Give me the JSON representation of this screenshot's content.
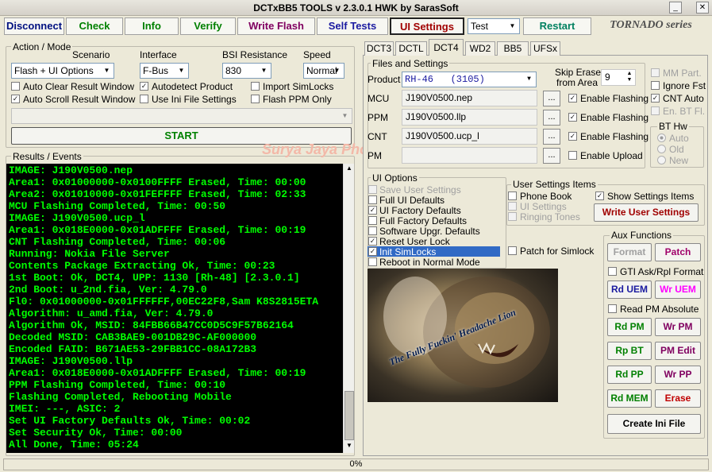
{
  "window": {
    "title": "DCTxBB5 TOOLS v 2.3.0.1 HWK by SarasSoft"
  },
  "toolbar": {
    "disconnect": "Disconnect",
    "check": "Check",
    "info": "Info",
    "verify": "Verify",
    "write_flash": "Write Flash",
    "self_tests": "Self Tests",
    "ui_settings": "UI Settings",
    "test_combo": "Test",
    "restart": "Restart",
    "brand": "TORNADO series"
  },
  "action_mode": {
    "group": "Action / Mode",
    "scenario_label": "Scenario",
    "scenario_value": "Flash + UI Options",
    "interface_label": "Interface",
    "interface_value": "F-Bus",
    "bsi_label": "BSI Resistance",
    "bsi_value": "830",
    "speed_label": "Speed",
    "speed_value": "Normal",
    "auto_clear": "Auto Clear Result Window",
    "autodetect": "Autodetect Product",
    "import_simlocks": "Import SimLocks",
    "auto_scroll": "Auto Scroll Result Window",
    "use_ini": "Use Ini File Settings",
    "flash_ppm": "Flash PPM Only",
    "start": "START"
  },
  "results": {
    "group": "Results / Events",
    "watermark": "Surya Jaya Phones",
    "lines": [
      "IMAGE: J190V0500.nep",
      "Area1: 0x01000000-0x0100FFFF Erased, Time: 00:00",
      "Area2: 0x01010000-0x01FEFFFF Erased, Time: 02:33",
      "MCU Flashing Completed, Time: 00:50",
      "IMAGE: J190V0500.ucp_l",
      "Area1: 0x018E0000-0x01ADFFFF Erased, Time: 00:19",
      "CNT Flashing Completed, Time: 00:06",
      "Running: Nokia File Server",
      "Contents Package Extracting Ok, Time: 00:23",
      "1st Boot: Ok, DCT4, UPP: 1130 [Rh-48] [2.3.0.1]",
      "2nd Boot: u_2nd.fia, Ver: 4.79.0",
      "Fl0: 0x01000000-0x01FFFFFF,00EC22F8,Sam K8S2815ETA",
      "Algorithm: u_amd.fia, Ver: 4.79.0",
      "Algorithm Ok, MSID: 84FBB66B47CC0D5C9F57B62164",
      "Decoded MSID: CAB3BAE9-001DB29C-AF000000",
      "Encoded FAID: B671AE53-29FBB1CC-08A172B3",
      "IMAGE: J190V0500.llp",
      "Area1: 0x018E0000-0x01ADFFFF Erased, Time: 00:19",
      "PPM Flashing Completed, Time: 00:10",
      "Flashing Completed, Rebooting Mobile",
      "IMEI: ---, ASIC: 2",
      "Set UI Factory Defaults Ok, Time: 00:02",
      "Set Security Ok, Time: 00:00",
      "All Done, Time: 05:24"
    ]
  },
  "tabs": [
    "DCT3",
    "DCTL",
    "DCT4",
    "WD2",
    "BB5",
    "UFSx"
  ],
  "files": {
    "group": "Files and Settings",
    "product_label": "Product",
    "product_value": "RH-46   (3105)",
    "skip_erase_label1": "Skip Erase",
    "skip_erase_label2": "from Area",
    "skip_erase_value": "9",
    "mcu_label": "MCU",
    "mcu_value": "J190V0500.nep",
    "ppm_label": "PPM",
    "ppm_value": "J190V0500.llp",
    "cnt_label": "CNT",
    "cnt_value": "J190V0500.ucp_l",
    "pm_label": "PM",
    "pm_value": "",
    "browse": "...",
    "enable_flashing": "Enable Flashing",
    "enable_upload": "Enable Upload",
    "mm_part": "MM Part.",
    "ignore_fst": "Ignore Fst",
    "cnt_auto": "CNT Auto",
    "en_bt_fl": "En. BT Fl.",
    "bt_hw": "BT Hw",
    "bt_auto": "Auto",
    "bt_old": "Old",
    "bt_new": "New"
  },
  "ui_options": {
    "group": "UI Options",
    "items": [
      "Save User Settings",
      "Full UI Defaults",
      "UI Factory Defaults",
      "Full Factory Defaults",
      "Software Upgr. Defaults",
      "Reset User Lock",
      "Init SimLocks",
      "Reboot in Normal Mode"
    ],
    "patch_simlock": "Patch for Simlock"
  },
  "user_settings": {
    "group": "User Settings Items",
    "phone_book": "Phone Book",
    "ui_settings": "UI Settings",
    "ringing_tones": "Ringing Tones",
    "show_items": "Show Settings Items",
    "write_button": "Write User Settings"
  },
  "image": {
    "caption": "The Fully Fuckin' Headache Lion"
  },
  "aux": {
    "group": "Aux Functions",
    "format": "Format",
    "patch": "Patch",
    "gti": "GTI Ask/Rpl Format",
    "rd_uem": "Rd UEM",
    "wr_uem": "Wr UEM",
    "read_pm_abs": "Read PM Absolute",
    "rd_pm": "Rd PM",
    "wr_pm": "Wr PM",
    "rp_bt": "Rp BT",
    "pm_edit": "PM Edit",
    "rd_pp": "Rd PP",
    "wr_pp": "Wr PP",
    "rd_mem": "Rd MEM",
    "erase": "Erase",
    "create_ini": "Create Ini File"
  },
  "status": {
    "progress": "0%"
  },
  "colors": {
    "log_bg": "#000000",
    "log_text": "#00ff00",
    "accent_green": "#008000",
    "accent_blue": "#1a1aa0",
    "accent_red": "#a00000",
    "magenta": "#ff00ff"
  }
}
